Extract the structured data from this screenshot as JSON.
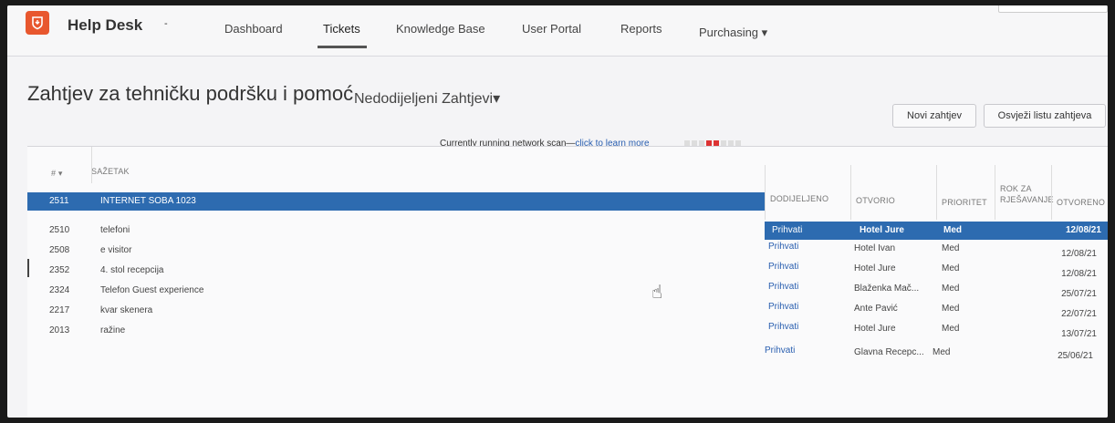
{
  "app": {
    "title": "Help Desk",
    "caret": "-"
  },
  "nav": {
    "items": [
      {
        "label": "Dashboard"
      },
      {
        "label": "Tickets"
      },
      {
        "label": "Knowledge Base"
      },
      {
        "label": "User Portal"
      },
      {
        "label": "Reports"
      },
      {
        "label": "Purchasing ▾"
      }
    ],
    "active": "Tickets"
  },
  "page": {
    "title": "Zahtjev za tehničku podršku i pomoć",
    "view": "Nedodijeljeni Zahtjevi▾"
  },
  "buttons": {
    "new_ticket": "Novi zahtjev",
    "refresh": "Osvježi listu zahtjeva"
  },
  "scan": {
    "text": "Currently running network scan—",
    "link": "click to learn more"
  },
  "table": {
    "headers": {
      "id": "# ▾",
      "summary": "SAŽETAK",
      "assigned": "DODIJELJENO",
      "opened_by": "OTVORIO",
      "priority": "PRIORITET",
      "due": "ROK ZA RJEŠAVANJE",
      "opened": "OTVORENO"
    },
    "rows": [
      {
        "id": "2511",
        "summary": "INTERNET SOBA 1023",
        "assigned": "",
        "opened_by": "",
        "priority": "",
        "date": ""
      },
      {
        "id": "2510",
        "summary": "telefoni",
        "assigned": "Prihvati",
        "opened_by": "Hotel Jure",
        "priority": "Med",
        "date": "12/08/21"
      },
      {
        "id": "2508",
        "summary": "e visitor",
        "assigned": "Prihvati",
        "opened_by": "Hotel Ivan",
        "priority": "Med",
        "date": "12/08/21"
      },
      {
        "id": "2352",
        "summary": "4. stol recepcija",
        "assigned": "Prihvati",
        "opened_by": "Hotel Jure",
        "priority": "Med",
        "date": "12/08/21"
      },
      {
        "id": "2324",
        "summary": "Telefon Guest experience",
        "assigned": "Prihvati",
        "opened_by": "Blaženka Mač...",
        "priority": "Med",
        "date": "25/07/21"
      },
      {
        "id": "2217",
        "summary": "kvar skenera",
        "assigned": "Prihvati",
        "opened_by": "Ante Pavić",
        "priority": "Med",
        "date": "22/07/21"
      },
      {
        "id": "2013",
        "summary": "ražine",
        "assigned": "Prihvati",
        "opened_by": "Hotel Jure",
        "priority": "Med",
        "date": "13/07/21"
      },
      {
        "id": "",
        "summary": "",
        "assigned": "Prihvati",
        "opened_by": "Glavna Recepc...",
        "priority": "Med",
        "date": "25/06/21"
      }
    ]
  },
  "colors": {
    "accent": "#2d6bb0",
    "logo": "#e8572e",
    "link": "#2a5fb0"
  }
}
